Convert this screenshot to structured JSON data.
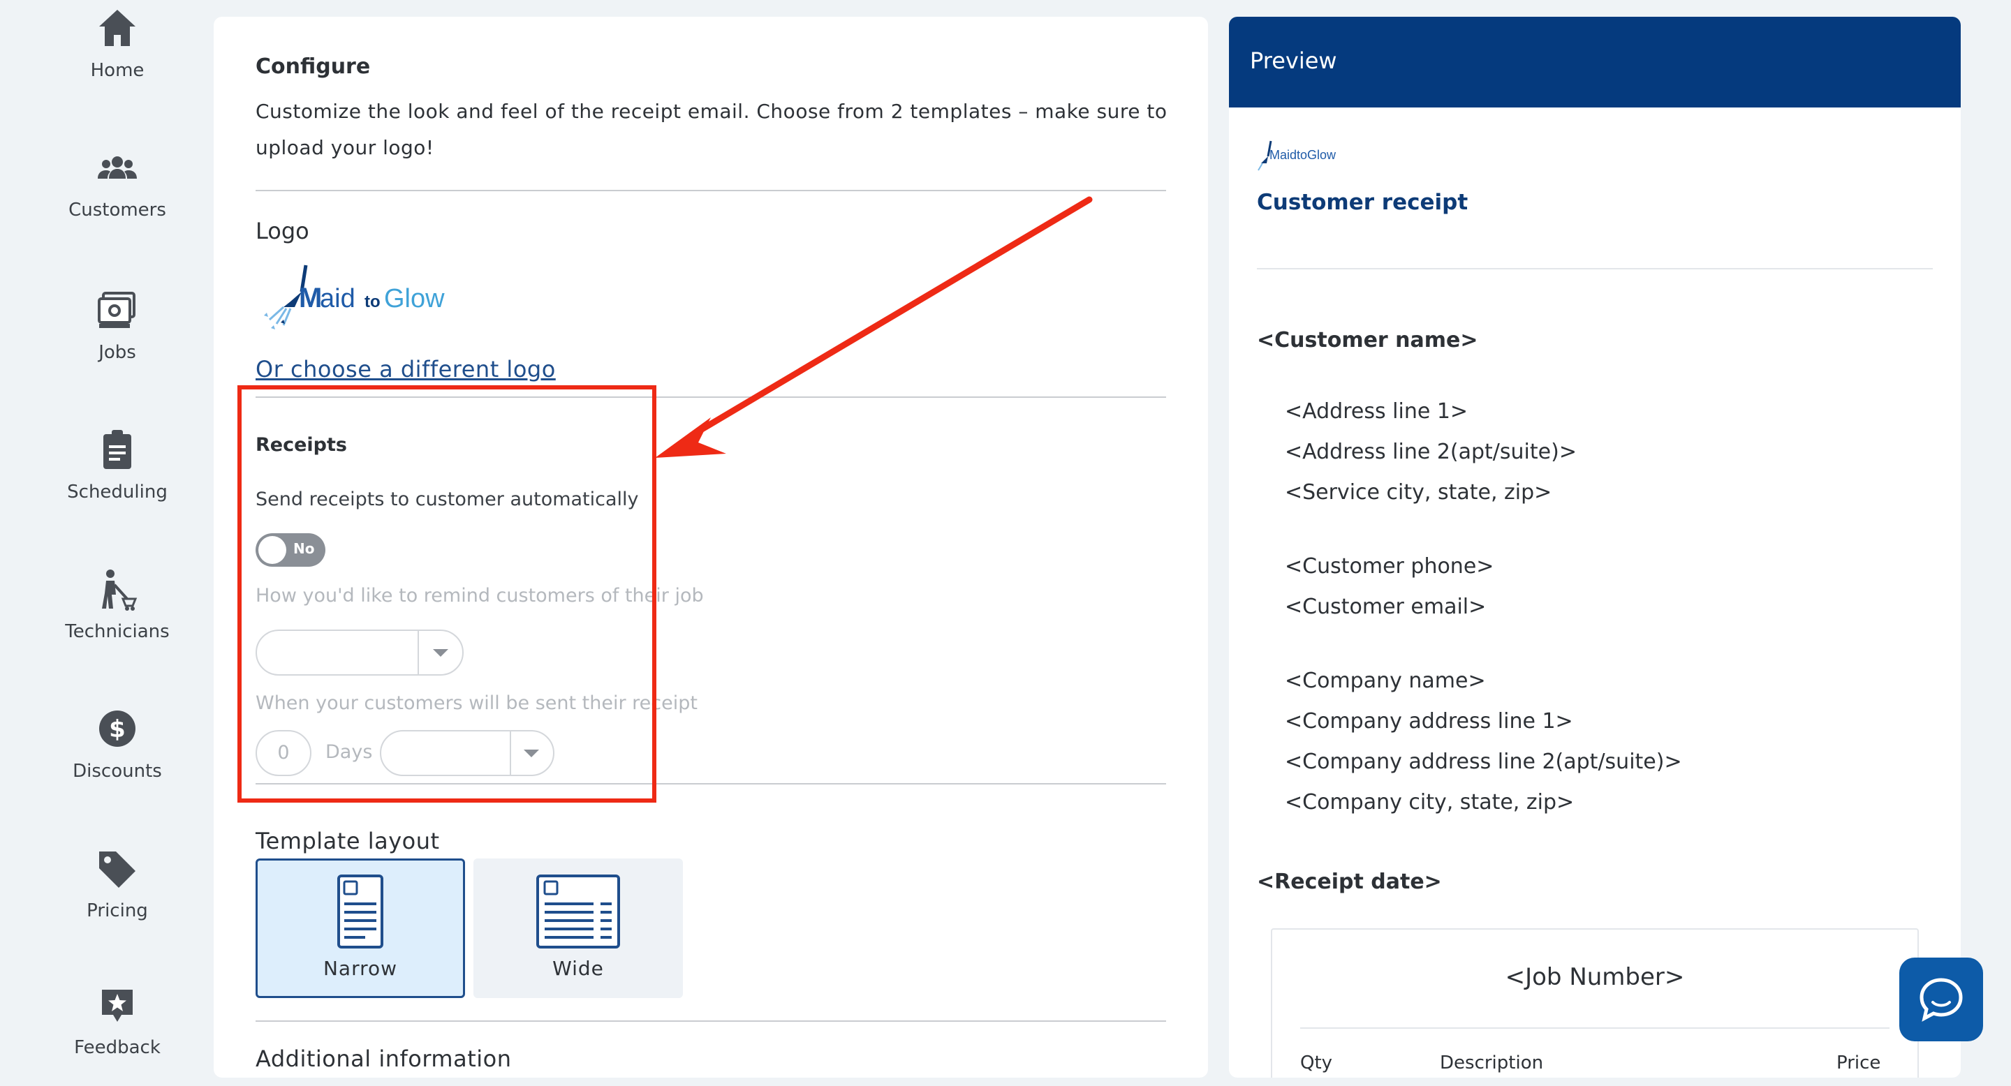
{
  "sidebar": {
    "items": [
      {
        "label": "Home",
        "icon": "home-icon"
      },
      {
        "label": "Customers",
        "icon": "users-icon"
      },
      {
        "label": "Jobs",
        "icon": "jobs-icon"
      },
      {
        "label": "Scheduling",
        "icon": "clipboard-icon"
      },
      {
        "label": "Technicians",
        "icon": "technician-icon"
      },
      {
        "label": "Discounts",
        "icon": "dollar-icon"
      },
      {
        "label": "Pricing",
        "icon": "price-tag-icon"
      },
      {
        "label": "Feedback",
        "icon": "star-badge-icon"
      }
    ]
  },
  "config": {
    "title": "Configure",
    "description": "Customize the look and feel of the receipt email. Choose from 2 templates – make sure to upload your logo!",
    "logo_heading": "Logo",
    "logo_brand_main": "aid",
    "logo_brand_to": "to",
    "logo_brand_glow": "Glow",
    "choose_logo_link": "Or choose a different logo",
    "receipts": {
      "heading": "Receipts",
      "send_auto_label": "Send receipts to customer automatically",
      "toggle_state": "No",
      "remind_label": "How you'd like to remind customers of their job",
      "remind_value": "",
      "sent_label": "When your customers will be sent their receipt",
      "days_value": "0",
      "days_label": "Days",
      "timing_value": ""
    },
    "template": {
      "heading": "Template layout",
      "options": [
        {
          "label": "Narrow",
          "selected": true
        },
        {
          "label": "Wide",
          "selected": false
        }
      ]
    },
    "additional_heading": "Additional information"
  },
  "preview": {
    "header": "Preview",
    "logo_text": "MaidtoGlow",
    "receipt_title": "Customer receipt",
    "customer_name": "<Customer name>",
    "address_line1": "<Address line 1>",
    "address_line2": "<Address line 2(apt/suite)>",
    "service_city": "<Service city, state, zip>",
    "customer_phone": "<Customer phone>",
    "customer_email": "<Customer email>",
    "company_name": "<Company name>",
    "company_address1": "<Company address line 1>",
    "company_address2": "<Company address line 2(apt/suite)>",
    "company_city": "<Company city, state, zip>",
    "receipt_date": "<Receipt date>",
    "job_number": "<Job Number>",
    "columns": [
      "Qty",
      "Description",
      "Price"
    ]
  },
  "colors": {
    "brand_navy": "#053a7e",
    "highlight_red": "#ee2a15",
    "link_blue": "#1f4e8c",
    "chat_blue": "#0d5ba8"
  }
}
